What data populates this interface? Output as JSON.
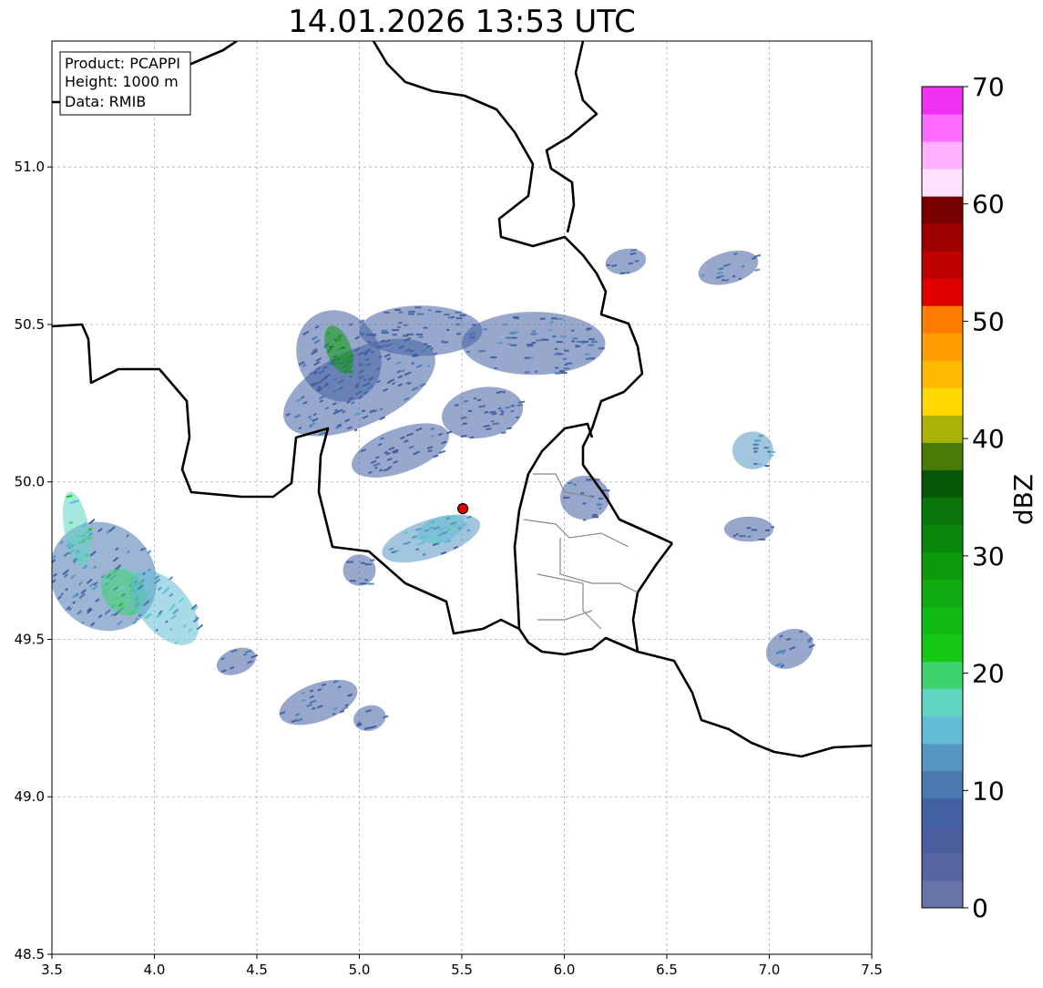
{
  "title": "14.01.2026 13:53 UTC",
  "info_box": {
    "product": "Product: PCAPPI",
    "height": "Height: 1000 m",
    "data": "Data: RMIB"
  },
  "map": {
    "lon_range": [
      3.5,
      7.5
    ],
    "lat_range": [
      48.5,
      51.4
    ],
    "x_ticks": [
      3.5,
      4.0,
      4.5,
      5.0,
      5.5,
      6.0,
      6.5,
      7.0,
      7.5
    ],
    "y_ticks": [
      48.5,
      49.0,
      49.5,
      50.0,
      50.5,
      51.0
    ],
    "grid": true,
    "radar_site": {
      "lon": 5.505,
      "lat": 49.915,
      "color": "#e00000"
    }
  },
  "colorbar": {
    "label": "dBZ",
    "min": 0,
    "max": 70,
    "ticks": [
      "0",
      "10",
      "20",
      "30",
      "40",
      "50",
      "60",
      "70"
    ],
    "colors": [
      "#6674a8",
      "#5766a0",
      "#4a5d9e",
      "#4360a2",
      "#4a78b0",
      "#5596c2",
      "#62bcd6",
      "#5ed6c3",
      "#3dd46e",
      "#14c814",
      "#11bb11",
      "#0faa10",
      "#0d9a0d",
      "#0a870a",
      "#087608",
      "#065806",
      "#487a06",
      "#aab406",
      "#ffd800",
      "#ffb800",
      "#ff9c00",
      "#ff7c00",
      "#e00000",
      "#c10000",
      "#a00000",
      "#7a0000",
      "#ffe0ff",
      "#ffb0ff",
      "#ff6cff",
      "#f030f0"
    ]
  },
  "echoes": [
    {
      "lon": 4.9,
      "lat": 50.4,
      "rx": 0.2,
      "ry": 0.15,
      "rot": -30,
      "dbz": 8
    },
    {
      "lon": 5.0,
      "lat": 50.3,
      "rx": 0.4,
      "ry": 0.12,
      "rot": -25,
      "dbz": 9
    },
    {
      "lon": 4.9,
      "lat": 50.42,
      "rx": 0.06,
      "ry": 0.08,
      "rot": -20,
      "dbz": 30
    },
    {
      "lon": 5.3,
      "lat": 50.48,
      "rx": 0.3,
      "ry": 0.08,
      "rot": 0,
      "dbz": 8
    },
    {
      "lon": 5.85,
      "lat": 50.44,
      "rx": 0.35,
      "ry": 0.1,
      "rot": 0,
      "dbz": 9
    },
    {
      "lon": 5.6,
      "lat": 50.22,
      "rx": 0.2,
      "ry": 0.08,
      "rot": -10,
      "dbz": 8
    },
    {
      "lon": 5.2,
      "lat": 50.1,
      "rx": 0.25,
      "ry": 0.07,
      "rot": -20,
      "dbz": 8
    },
    {
      "lon": 5.35,
      "lat": 49.82,
      "rx": 0.25,
      "ry": 0.06,
      "rot": -18,
      "dbz": 12
    },
    {
      "lon": 5.4,
      "lat": 49.85,
      "rx": 0.12,
      "ry": 0.04,
      "rot": -18,
      "dbz": 16
    },
    {
      "lon": 5.0,
      "lat": 49.72,
      "rx": 0.08,
      "ry": 0.05,
      "rot": 0,
      "dbz": 9
    },
    {
      "lon": 6.1,
      "lat": 49.95,
      "rx": 0.12,
      "ry": 0.07,
      "rot": 0,
      "dbz": 7
    },
    {
      "lon": 6.8,
      "lat": 50.68,
      "rx": 0.15,
      "ry": 0.05,
      "rot": -15,
      "dbz": 9
    },
    {
      "lon": 6.3,
      "lat": 50.7,
      "rx": 0.1,
      "ry": 0.04,
      "rot": -10,
      "dbz": 8
    },
    {
      "lon": 6.92,
      "lat": 50.1,
      "rx": 0.1,
      "ry": 0.06,
      "rot": 0,
      "dbz": 12
    },
    {
      "lon": 6.9,
      "lat": 49.85,
      "rx": 0.12,
      "ry": 0.04,
      "rot": 0,
      "dbz": 7
    },
    {
      "lon": 7.1,
      "lat": 49.47,
      "rx": 0.12,
      "ry": 0.06,
      "rot": -25,
      "dbz": 9
    },
    {
      "lon": 3.75,
      "lat": 49.7,
      "rx": 0.25,
      "ry": 0.18,
      "rot": -40,
      "dbz": 10
    },
    {
      "lon": 3.85,
      "lat": 49.65,
      "rx": 0.1,
      "ry": 0.08,
      "rot": -40,
      "dbz": 20
    },
    {
      "lon": 4.05,
      "lat": 49.6,
      "rx": 0.12,
      "ry": 0.14,
      "rot": -40,
      "dbz": 14
    },
    {
      "lon": 3.62,
      "lat": 49.85,
      "rx": 0.06,
      "ry": 0.12,
      "rot": -10,
      "dbz": 18
    },
    {
      "lon": 4.4,
      "lat": 49.43,
      "rx": 0.1,
      "ry": 0.04,
      "rot": -20,
      "dbz": 8
    },
    {
      "lon": 4.8,
      "lat": 49.3,
      "rx": 0.2,
      "ry": 0.06,
      "rot": -20,
      "dbz": 9
    },
    {
      "lon": 5.05,
      "lat": 49.25,
      "rx": 0.08,
      "ry": 0.04,
      "rot": -15,
      "dbz": 8
    }
  ]
}
